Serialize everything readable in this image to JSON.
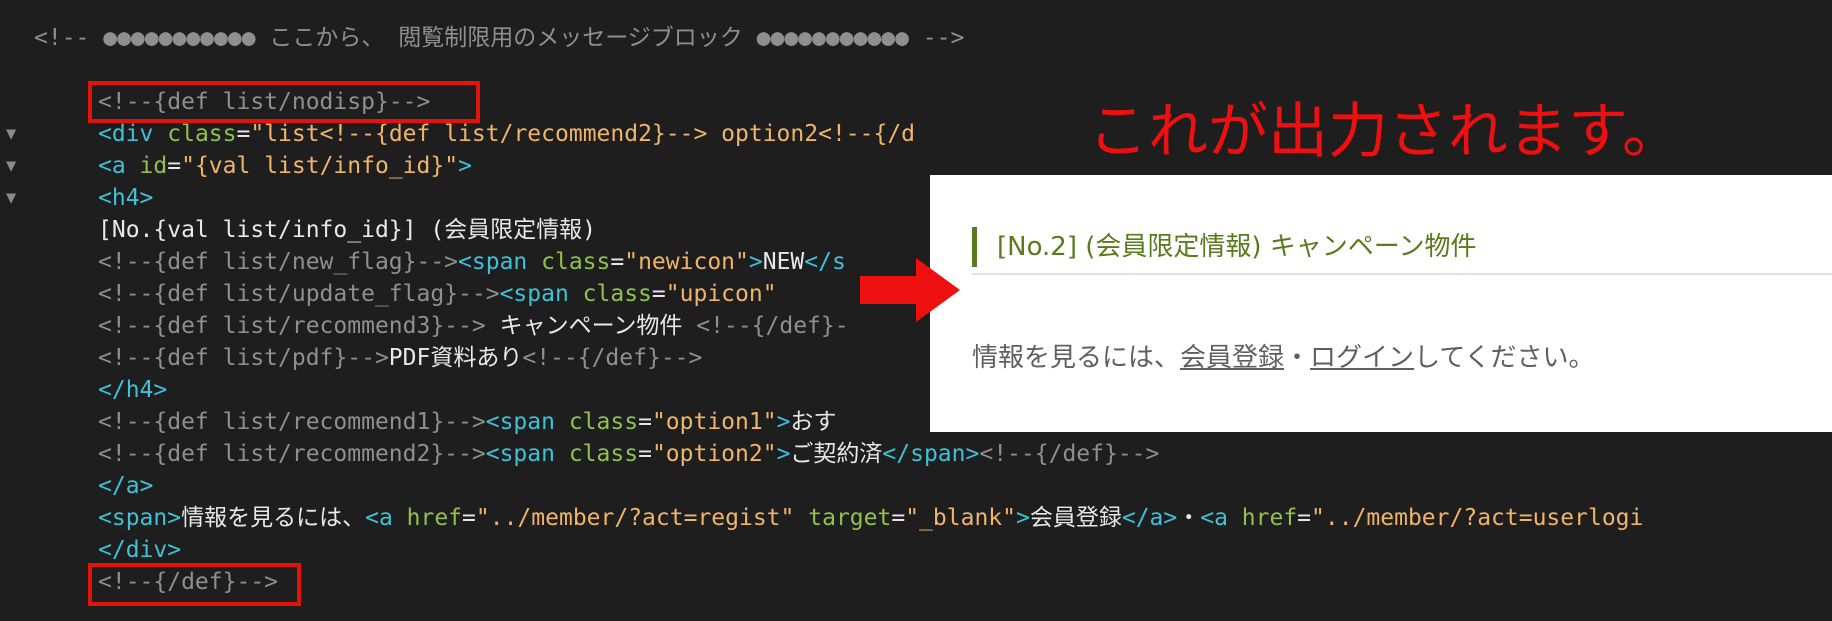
{
  "code": {
    "lines": [
      [
        [
          "c",
          "<!-- ●●●●●●●●●●● ここから、 閲覧制限用のメッセージブロック ●●●●●●●●●●● -->"
        ]
      ],
      [],
      [
        [
          "c",
          "<!--{def list/nodisp}-->"
        ]
      ],
      [
        [
          "t",
          "<div "
        ],
        [
          "a",
          "class"
        ],
        [
          "x",
          "="
        ],
        [
          "s",
          "\"list<!--{def list/recommend2}--> option2<!--{/d"
        ]
      ],
      [
        [
          "t",
          "<a "
        ],
        [
          "a",
          "id"
        ],
        [
          "x",
          "="
        ],
        [
          "s",
          "\"{val list/info_id}\""
        ],
        [
          "t",
          ">"
        ]
      ],
      [
        [
          "t",
          "<h4>"
        ]
      ],
      [
        [
          "x",
          "[No.{val list/info_id}] (会員限定情報)"
        ]
      ],
      [
        [
          "c",
          "<!--{def list/new_flag}-->"
        ],
        [
          "t",
          "<span "
        ],
        [
          "a",
          "class"
        ],
        [
          "x",
          "="
        ],
        [
          "s",
          "\"newicon\""
        ],
        [
          "t",
          ">"
        ],
        [
          "x",
          "NEW"
        ],
        [
          "t",
          "</s"
        ]
      ],
      [
        [
          "c",
          "<!--{def list/update_flag}-->"
        ],
        [
          "t",
          "<span "
        ],
        [
          "a",
          "class"
        ],
        [
          "x",
          "="
        ],
        [
          "s",
          "\"upicon\""
        ]
      ],
      [
        [
          "c",
          "<!--{def list/recommend3}-->"
        ],
        [
          "x",
          " キャンペーン物件 "
        ],
        [
          "c",
          "<!--{/def}-"
        ]
      ],
      [
        [
          "c",
          "<!--{def list/pdf}-->"
        ],
        [
          "x",
          "PDF資料あり"
        ],
        [
          "c",
          "<!--{/def}-->"
        ]
      ],
      [
        [
          "t",
          "</h4>"
        ]
      ],
      [
        [
          "c",
          "<!--{def list/recommend1}-->"
        ],
        [
          "t",
          "<span "
        ],
        [
          "a",
          "class"
        ],
        [
          "x",
          "="
        ],
        [
          "s",
          "\"option1\""
        ],
        [
          "t",
          ">"
        ],
        [
          "x",
          "おす"
        ]
      ],
      [
        [
          "c",
          "<!--{def list/recommend2}-->"
        ],
        [
          "t",
          "<span "
        ],
        [
          "a",
          "class"
        ],
        [
          "x",
          "="
        ],
        [
          "s",
          "\"option2\""
        ],
        [
          "t",
          ">"
        ],
        [
          "x",
          "ご契約済"
        ],
        [
          "t",
          "</span>"
        ],
        [
          "c",
          "<!--{/def}-->"
        ]
      ],
      [
        [
          "t",
          "</a>"
        ]
      ],
      [
        [
          "t",
          "<span>"
        ],
        [
          "x",
          "情報を見るには、"
        ],
        [
          "t",
          "<a "
        ],
        [
          "a",
          "href"
        ],
        [
          "x",
          "="
        ],
        [
          "s",
          "\"../member/?act=regist\""
        ],
        [
          "x",
          " "
        ],
        [
          "a",
          "target"
        ],
        [
          "x",
          "="
        ],
        [
          "s",
          "\"_blank\""
        ],
        [
          "t",
          ">"
        ],
        [
          "x",
          "会員登録"
        ],
        [
          "t",
          "</a>"
        ],
        [
          "x",
          "・"
        ],
        [
          "t",
          "<a "
        ],
        [
          "a",
          "href"
        ],
        [
          "x",
          "="
        ],
        [
          "s",
          "\"../member/?act=userlogi"
        ]
      ],
      [
        [
          "t",
          "</div>"
        ]
      ],
      [
        [
          "c",
          "<!--{/def}-->"
        ]
      ]
    ],
    "fold_marker": "▼",
    "fold_lines": [
      3,
      4,
      5
    ]
  },
  "annotation": {
    "title": "これが出力されます。",
    "highlight_color": "#e3120b"
  },
  "preview": {
    "heading": "[No.2] (会員限定情報) キャンペーン物件",
    "message_prefix": "情報を見るには、",
    "link_register": "会員登録",
    "separator": "・",
    "link_login": "ログイン",
    "message_suffix": "してください。",
    "accent_color": "#5a7a1e"
  }
}
